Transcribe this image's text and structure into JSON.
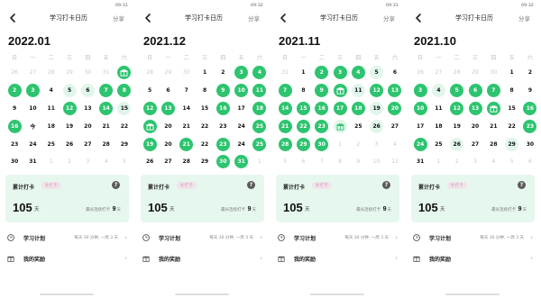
{
  "colors": {
    "accent": "#2dc46f",
    "accent_light": "#e1f6ea",
    "card_bg": "#e6f7ee"
  },
  "panels": [
    {
      "status_time": "09:31",
      "nav": {
        "back_icon": "chevron-left-icon",
        "title": "学习打卡日历",
        "share": "分享"
      },
      "month": "2022.01",
      "weekdays": [
        "日",
        "一",
        "二",
        "三",
        "四",
        "五",
        "六"
      ],
      "days": [
        {
          "d": "26",
          "s": "other"
        },
        {
          "d": "27",
          "s": "other"
        },
        {
          "d": "28",
          "s": "other"
        },
        {
          "d": "29",
          "s": "other"
        },
        {
          "d": "30",
          "s": "other"
        },
        {
          "d": "31",
          "s": "other"
        },
        {
          "d": "",
          "s": "gift"
        },
        {
          "d": "2",
          "s": "done"
        },
        {
          "d": "3",
          "s": "done"
        },
        {
          "d": "4",
          "s": ""
        },
        {
          "d": "5",
          "s": "light"
        },
        {
          "d": "6",
          "s": "light"
        },
        {
          "d": "7",
          "s": "done"
        },
        {
          "d": "8",
          "s": "done"
        },
        {
          "d": "9",
          "s": ""
        },
        {
          "d": "10",
          "s": ""
        },
        {
          "d": "11",
          "s": ""
        },
        {
          "d": "12",
          "s": "done"
        },
        {
          "d": "13",
          "s": ""
        },
        {
          "d": "14",
          "s": "done"
        },
        {
          "d": "15",
          "s": "light"
        },
        {
          "d": "16",
          "s": "done"
        },
        {
          "d": "今",
          "s": ""
        },
        {
          "d": "18",
          "s": ""
        },
        {
          "d": "19",
          "s": ""
        },
        {
          "d": "20",
          "s": ""
        },
        {
          "d": "21",
          "s": ""
        },
        {
          "d": "22",
          "s": ""
        },
        {
          "d": "23",
          "s": ""
        },
        {
          "d": "24",
          "s": ""
        },
        {
          "d": "25",
          "s": ""
        },
        {
          "d": "26",
          "s": ""
        },
        {
          "d": "27",
          "s": ""
        },
        {
          "d": "28",
          "s": ""
        },
        {
          "d": "29",
          "s": ""
        },
        {
          "d": "30",
          "s": ""
        },
        {
          "d": "31",
          "s": ""
        },
        {
          "d": "1",
          "s": "other"
        },
        {
          "d": "2",
          "s": "other"
        },
        {
          "d": "3",
          "s": "other"
        },
        {
          "d": "4",
          "s": "other"
        },
        {
          "d": "5",
          "s": "other"
        }
      ],
      "card": {
        "label": "累计打卡",
        "tag": "补打卡",
        "total": "105",
        "unit": "天",
        "streak_prefix": "最长连续打卡",
        "streak_value": "9",
        "streak_unit": "天"
      },
      "plan": {
        "label": "学习计划",
        "value": "每天 30 分钟, 一周 3 天"
      },
      "reward": {
        "label": "我的奖励"
      }
    },
    {
      "status_time": "09:32",
      "nav": {
        "back_icon": "chevron-left-icon",
        "title": "学习打卡日历",
        "share": "分享"
      },
      "month": "2021.12",
      "weekdays": [
        "日",
        "一",
        "二",
        "三",
        "四",
        "五",
        "六"
      ],
      "days": [
        {
          "d": "28",
          "s": "other"
        },
        {
          "d": "29",
          "s": "other"
        },
        {
          "d": "30",
          "s": "other"
        },
        {
          "d": "1",
          "s": ""
        },
        {
          "d": "2",
          "s": ""
        },
        {
          "d": "3",
          "s": "done"
        },
        {
          "d": "4",
          "s": "done"
        },
        {
          "d": "5",
          "s": ""
        },
        {
          "d": "6",
          "s": ""
        },
        {
          "d": "7",
          "s": ""
        },
        {
          "d": "8",
          "s": ""
        },
        {
          "d": "9",
          "s": "done"
        },
        {
          "d": "10",
          "s": "done"
        },
        {
          "d": "11",
          "s": "done"
        },
        {
          "d": "12",
          "s": "done"
        },
        {
          "d": "13",
          "s": "done"
        },
        {
          "d": "14",
          "s": ""
        },
        {
          "d": "15",
          "s": ""
        },
        {
          "d": "16",
          "s": "done"
        },
        {
          "d": "17",
          "s": ""
        },
        {
          "d": "18",
          "s": "done"
        },
        {
          "d": "",
          "s": "gift"
        },
        {
          "d": "20",
          "s": ""
        },
        {
          "d": "21",
          "s": ""
        },
        {
          "d": "22",
          "s": ""
        },
        {
          "d": "23",
          "s": ""
        },
        {
          "d": "24",
          "s": ""
        },
        {
          "d": "25",
          "s": "done"
        },
        {
          "d": "19",
          "s": "done"
        },
        {
          "d": "20",
          "s": ""
        },
        {
          "d": "21",
          "s": "done"
        },
        {
          "d": "22",
          "s": ""
        },
        {
          "d": "23",
          "s": "done"
        },
        {
          "d": "24",
          "s": ""
        },
        {
          "d": "25",
          "s": "done"
        },
        {
          "d": "26",
          "s": ""
        },
        {
          "d": "27",
          "s": ""
        },
        {
          "d": "28",
          "s": ""
        },
        {
          "d": "29",
          "s": ""
        },
        {
          "d": "30",
          "s": "done"
        },
        {
          "d": "31",
          "s": "done"
        },
        {
          "d": "1",
          "s": "other"
        }
      ],
      "card": {
        "label": "累计打卡",
        "tag": "补打卡",
        "total": "105",
        "unit": "天",
        "streak_prefix": "最长连续打卡",
        "streak_value": "9",
        "streak_unit": "天"
      },
      "plan": {
        "label": "学习计划",
        "value": "每天 30 分钟, 一周 3 天"
      },
      "reward": {
        "label": "我的奖励"
      }
    },
    {
      "status_time": "09:31",
      "nav": {
        "back_icon": "chevron-left-icon",
        "title": "学习打卡日历",
        "share": "分享"
      },
      "month": "2021.11",
      "weekdays": [
        "日",
        "一",
        "二",
        "三",
        "四",
        "五",
        "六"
      ],
      "days": [
        {
          "d": "31",
          "s": "other"
        },
        {
          "d": "1",
          "s": ""
        },
        {
          "d": "2",
          "s": "done"
        },
        {
          "d": "3",
          "s": "done"
        },
        {
          "d": "4",
          "s": "done"
        },
        {
          "d": "5",
          "s": "light"
        },
        {
          "d": "6",
          "s": ""
        },
        {
          "d": "7",
          "s": "done"
        },
        {
          "d": "8",
          "s": ""
        },
        {
          "d": "9",
          "s": "done"
        },
        {
          "d": "",
          "s": "gift"
        },
        {
          "d": "11",
          "s": "light"
        },
        {
          "d": "12",
          "s": "done"
        },
        {
          "d": "13",
          "s": "done"
        },
        {
          "d": "14",
          "s": "done"
        },
        {
          "d": "15",
          "s": "done"
        },
        {
          "d": "16",
          "s": "done"
        },
        {
          "d": "17",
          "s": "done"
        },
        {
          "d": "18",
          "s": "done"
        },
        {
          "d": "19",
          "s": "light"
        },
        {
          "d": "20",
          "s": "done"
        },
        {
          "d": "21",
          "s": "done"
        },
        {
          "d": "22",
          "s": "done"
        },
        {
          "d": "23",
          "s": "done"
        },
        {
          "d": "",
          "s": "giftlight"
        },
        {
          "d": "25",
          "s": ""
        },
        {
          "d": "26",
          "s": "light"
        },
        {
          "d": "27",
          "s": ""
        },
        {
          "d": "28",
          "s": "done"
        },
        {
          "d": "29",
          "s": "done"
        },
        {
          "d": "30",
          "s": "done"
        },
        {
          "d": "1",
          "s": "other"
        },
        {
          "d": "2",
          "s": "other"
        },
        {
          "d": "3",
          "s": "other"
        },
        {
          "d": "4",
          "s": "other"
        },
        {
          "d": "5",
          "s": "other"
        },
        {
          "d": "6",
          "s": "other"
        },
        {
          "d": "7",
          "s": "other"
        },
        {
          "d": "8",
          "s": "other"
        },
        {
          "d": "9",
          "s": "other"
        },
        {
          "d": "10",
          "s": "other"
        },
        {
          "d": "11",
          "s": "other"
        }
      ],
      "card": {
        "label": "累计打卡",
        "tag": "补打卡",
        "total": "105",
        "unit": "天",
        "streak_prefix": "最长连续打卡",
        "streak_value": "9",
        "streak_unit": "天"
      },
      "plan": {
        "label": "学习计划",
        "value": "每天 30 分钟, 一周 3 天"
      },
      "reward": {
        "label": "我的奖励"
      }
    },
    {
      "status_time": "09:32",
      "nav": {
        "back_icon": "chevron-left-icon",
        "title": "学习打卡日历",
        "share": "分享"
      },
      "month": "2021.10",
      "weekdays": [
        "日",
        "一",
        "二",
        "三",
        "四",
        "五",
        "六"
      ],
      "days": [
        {
          "d": "26",
          "s": "other"
        },
        {
          "d": "27",
          "s": "other"
        },
        {
          "d": "28",
          "s": "other"
        },
        {
          "d": "29",
          "s": "other"
        },
        {
          "d": "30",
          "s": "other"
        },
        {
          "d": "1",
          "s": ""
        },
        {
          "d": "2",
          "s": ""
        },
        {
          "d": "3",
          "s": "done"
        },
        {
          "d": "4",
          "s": "light"
        },
        {
          "d": "5",
          "s": "done"
        },
        {
          "d": "6",
          "s": "done"
        },
        {
          "d": "7",
          "s": "done"
        },
        {
          "d": "8",
          "s": ""
        },
        {
          "d": "9",
          "s": ""
        },
        {
          "d": "10",
          "s": "done"
        },
        {
          "d": "11",
          "s": ""
        },
        {
          "d": "12",
          "s": "done"
        },
        {
          "d": "13",
          "s": "done"
        },
        {
          "d": "",
          "s": "gift"
        },
        {
          "d": "15",
          "s": ""
        },
        {
          "d": "16",
          "s": "done"
        },
        {
          "d": "17",
          "s": ""
        },
        {
          "d": "18",
          "s": ""
        },
        {
          "d": "19",
          "s": ""
        },
        {
          "d": "20",
          "s": ""
        },
        {
          "d": "21",
          "s": ""
        },
        {
          "d": "22",
          "s": ""
        },
        {
          "d": "23",
          "s": "done"
        },
        {
          "d": "24",
          "s": "done"
        },
        {
          "d": "25",
          "s": ""
        },
        {
          "d": "26",
          "s": "light"
        },
        {
          "d": "27",
          "s": ""
        },
        {
          "d": "28",
          "s": ""
        },
        {
          "d": "29",
          "s": "light"
        },
        {
          "d": "30",
          "s": ""
        },
        {
          "d": "31",
          "s": ""
        },
        {
          "d": "1",
          "s": "other"
        },
        {
          "d": "2",
          "s": "other"
        },
        {
          "d": "3",
          "s": "other"
        },
        {
          "d": "4",
          "s": "other"
        },
        {
          "d": "5",
          "s": "other"
        },
        {
          "d": "6",
          "s": "other"
        }
      ],
      "card": {
        "label": "累计打卡",
        "tag": "补打卡",
        "total": "105",
        "unit": "天",
        "streak_prefix": "最长连续打卡",
        "streak_value": "9",
        "streak_unit": "天"
      },
      "plan": {
        "label": "学习计划",
        "value": "每天 30 分钟, 一周 3 天"
      },
      "reward": {
        "label": "我的奖励"
      }
    }
  ]
}
